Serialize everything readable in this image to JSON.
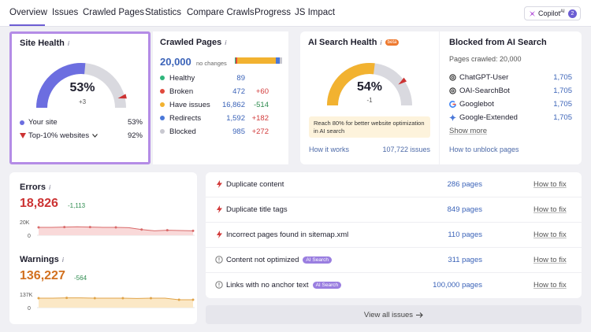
{
  "nav": {
    "tabs": [
      "Overview",
      "Issues",
      "Crawled Pages",
      "Statistics",
      "Compare Crawls",
      "Progress",
      "JS Impact"
    ],
    "copilot_label": "Copilot",
    "copilot_sup": "AI",
    "copilot_badge": "2"
  },
  "site_health": {
    "title": "Site Health",
    "percent": "53%",
    "percent_value": 53,
    "delta": "+3",
    "your_site_label": "Your site",
    "your_site_value": "53%",
    "top_label": "Top-10% websites",
    "top_value": "92%",
    "top_value_num": 92
  },
  "crawled_pages": {
    "title": "Crawled Pages",
    "total": "20,000",
    "no_changes": "no changes",
    "rows": [
      {
        "label": "Healthy",
        "count": "89",
        "change": "",
        "color": "#2fb57b"
      },
      {
        "label": "Broken",
        "count": "472",
        "change": "+60",
        "color": "#e0493c"
      },
      {
        "label": "Have issues",
        "count": "16,862",
        "change": "-514",
        "color": "#f2b230"
      },
      {
        "label": "Redirects",
        "count": "1,592",
        "change": "+182",
        "color": "#4a78d8"
      },
      {
        "label": "Blocked",
        "count": "985",
        "change": "+272",
        "color": "#c8c8d0"
      }
    ]
  },
  "ai_health": {
    "title": "AI Search Health",
    "beta": "beta",
    "percent": "54%",
    "percent_value": 54,
    "delta": "-1",
    "tip": "Reach 80% for better website optimization in AI search",
    "how_link": "How it works",
    "issues_link": "107,722 issues"
  },
  "blocked": {
    "title": "Blocked from AI Search",
    "subtitle": "Pages crawled: 20,000",
    "rows": [
      {
        "label": "ChatGPT-User",
        "count": "1,705",
        "icon": "openai-icon"
      },
      {
        "label": "OAI-SearchBot",
        "count": "1,705",
        "icon": "openai-icon"
      },
      {
        "label": "Googlebot",
        "count": "1,705",
        "icon": "google-icon"
      },
      {
        "label": "Google-Extended",
        "count": "1,705",
        "icon": "gemini-icon"
      }
    ],
    "show_more": "Show more",
    "unblock_link": "How to unblock pages"
  },
  "errors": {
    "title": "Errors",
    "value": "18,826",
    "delta": "-1,113",
    "axis_top": "20K",
    "axis_bottom": "0",
    "trend": [
      0.5,
      0.5,
      0.52,
      0.54,
      0.52,
      0.5,
      0.5,
      0.48,
      0.36,
      0.28,
      0.32,
      0.3,
      0.28
    ]
  },
  "warnings": {
    "title": "Warnings",
    "value": "136,227",
    "delta": "-564",
    "axis_top": "137K",
    "axis_bottom": "0",
    "trend": [
      0.6,
      0.6,
      0.62,
      0.62,
      0.6,
      0.6,
      0.6,
      0.58,
      0.6,
      0.6,
      0.5,
      0.5
    ]
  },
  "issues": {
    "rows": [
      {
        "label": "Duplicate content",
        "tag": "",
        "count": "286 pages",
        "fix": "How to fix",
        "icon": "error-icon"
      },
      {
        "label": "Duplicate title tags",
        "tag": "",
        "count": "849 pages",
        "fix": "How to fix",
        "icon": "error-icon"
      },
      {
        "label": "Incorrect pages found in sitemap.xml",
        "tag": "",
        "count": "110 pages",
        "fix": "How to fix",
        "icon": "error-icon"
      },
      {
        "label": "Content not optimized",
        "tag": "AI Search",
        "count": "311 pages",
        "fix": "How to fix",
        "icon": "warning-icon"
      },
      {
        "label": "Links with no anchor text",
        "tag": "AI Search",
        "count": "100,000 pages",
        "fix": "How to fix",
        "icon": "warning-icon"
      }
    ],
    "view_all": "View all issues"
  },
  "colors": {
    "accent": "#6c5dd3",
    "gauge_purple": "#6c6ee0",
    "gauge_yellow": "#f2b230",
    "error_red": "#cc3333",
    "warning_orange": "#d2701f",
    "highlight_border": "#b48ce6"
  }
}
